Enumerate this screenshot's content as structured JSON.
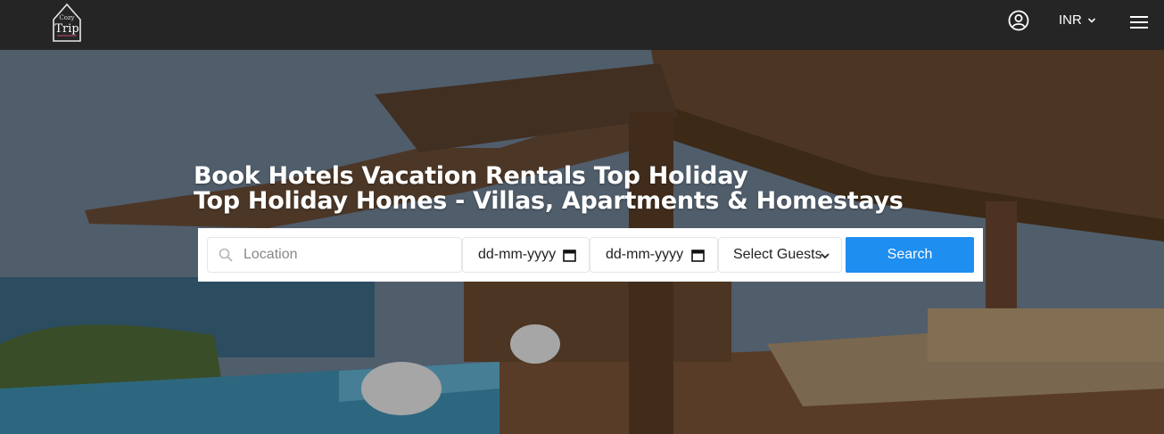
{
  "brand": {
    "small": "Cozy",
    "main": "Trip"
  },
  "header": {
    "currency": "INR"
  },
  "hero": {
    "line1": "Book Hotels Vacation Rentals Top Holiday",
    "line2": "Top Holiday Homes - Villas, Apartments & Homestays"
  },
  "search": {
    "location_placeholder": "Location",
    "checkin_value": "dd-mm-yyyy",
    "checkout_value": "dd-mm-yyyy",
    "guests_label": "Select Guests",
    "button_label": "Search"
  },
  "colors": {
    "topbar": "#252525",
    "accent": "#1f8ef1"
  }
}
